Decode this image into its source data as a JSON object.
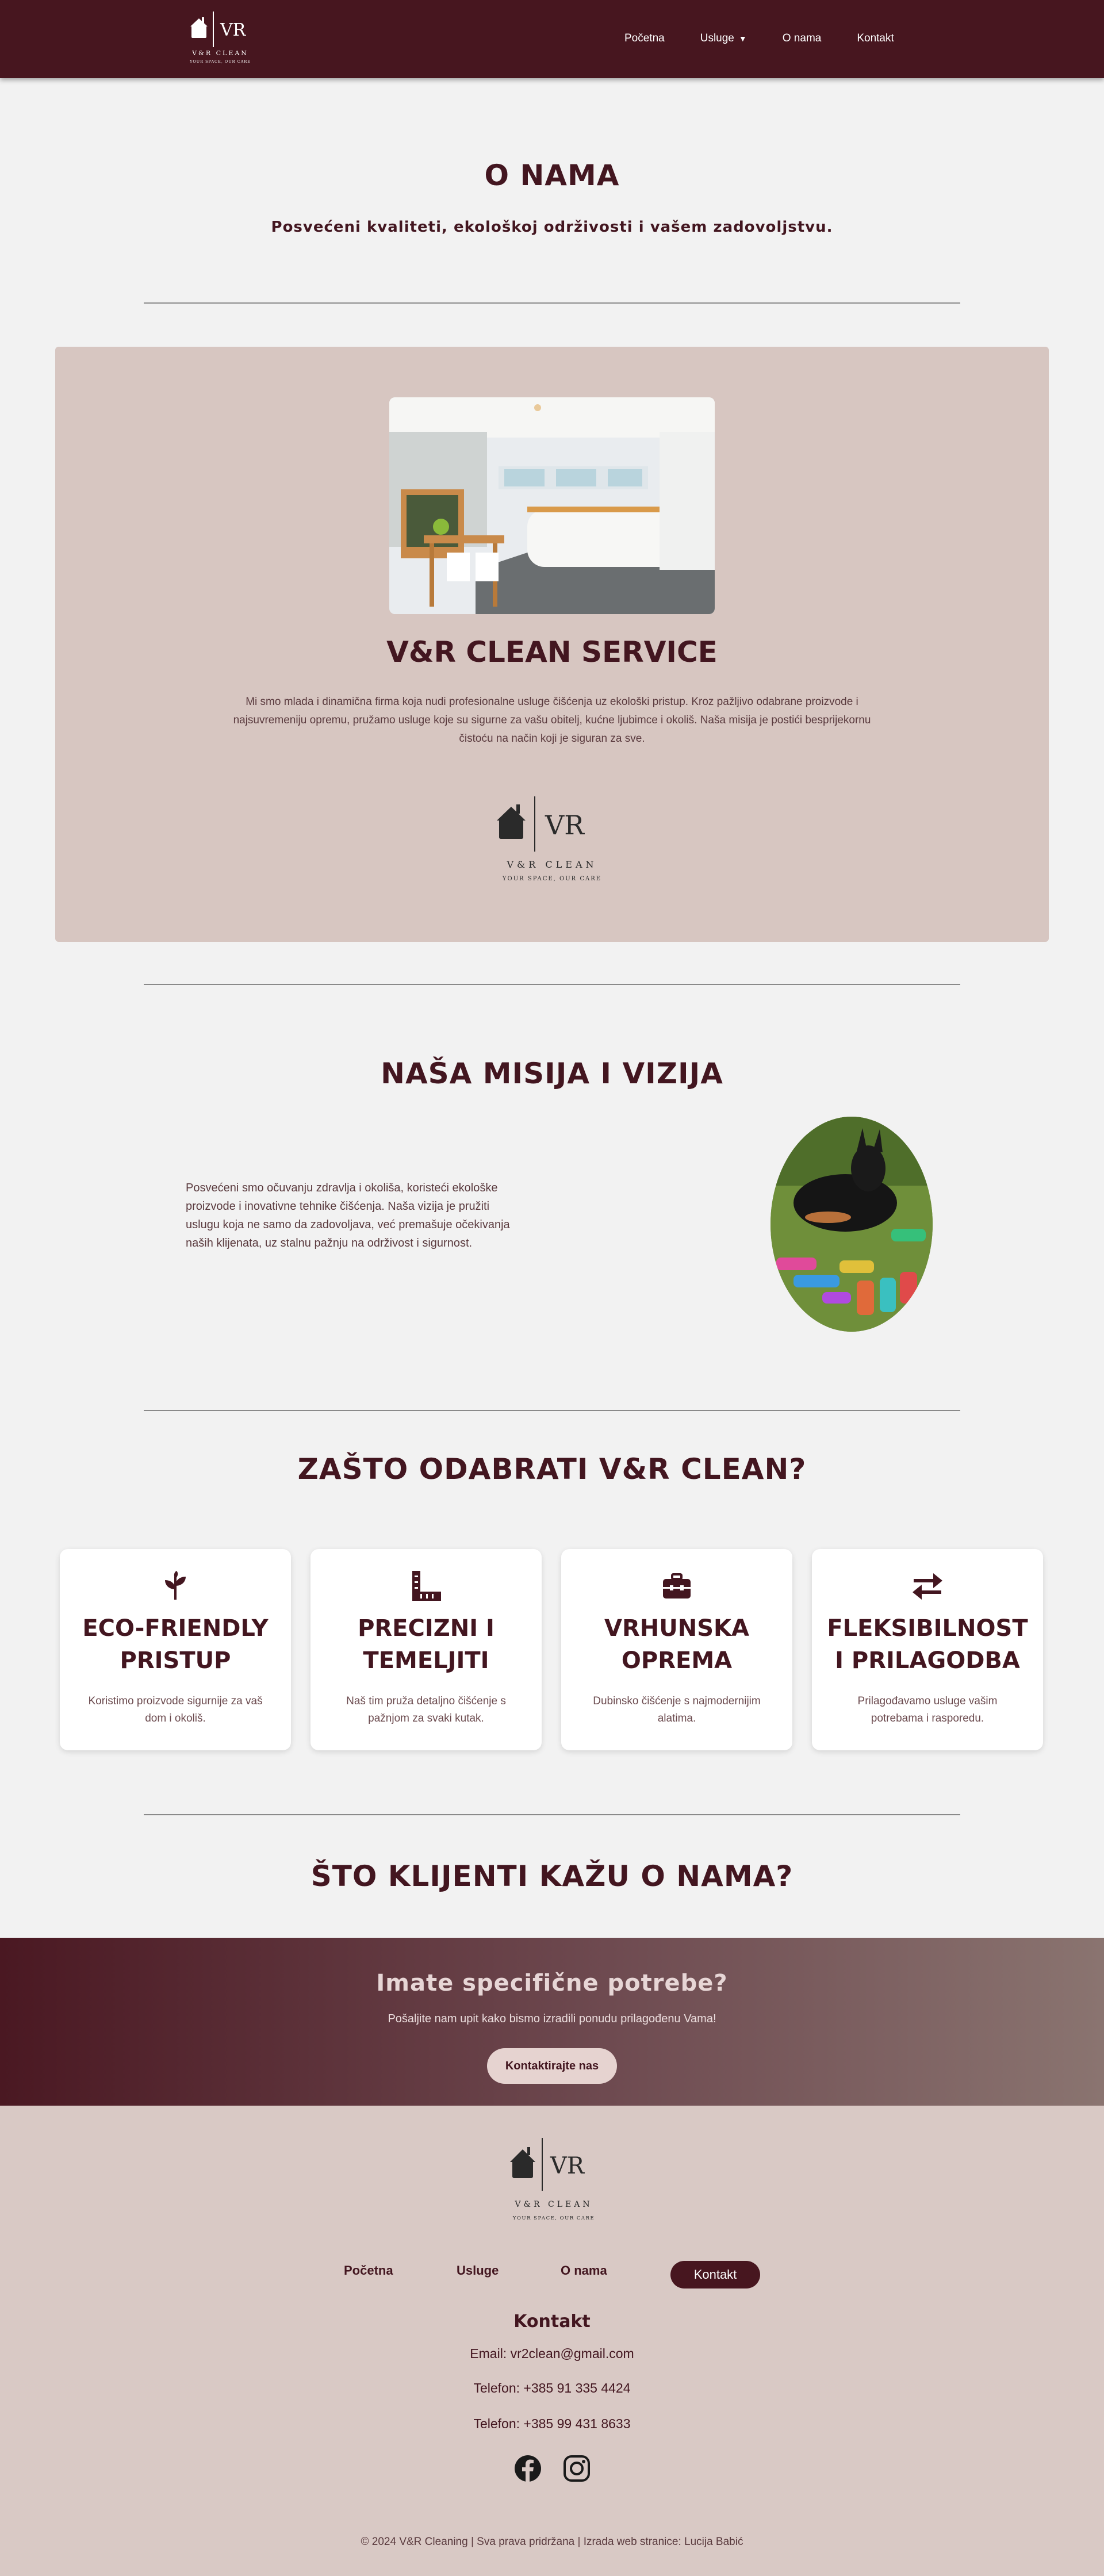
{
  "nav": {
    "logo_letters": "VR",
    "logo_name": "V&R CLEAN",
    "logo_tagline": "YOUR SPACE, OUR CARE",
    "links": [
      "Početna",
      "Usluge",
      "O nama",
      "Kontakt"
    ],
    "caret": "▼"
  },
  "hero": {
    "title": "O NAMA",
    "subtitle": "Posvećeni kvaliteti, ekološkoj održivosti i vašem zadovoljstvu."
  },
  "about": {
    "title": "V&R CLEAN SERVICE",
    "text": "Mi smo mlada i dinamična firma koja nudi profesionalne usluge čišćenja uz ekološki pristup. Kroz pažljivo odabrane proizvode i najsuvremeniju opremu, pružamo usluge koje su sigurne za vašu obitelj, kućne ljubimce i okoliš. Naša misija je postići besprijekornu čistoću na način koji je siguran za sve.",
    "logo_letters": "VR",
    "logo_name": "V&R CLEAN",
    "logo_tagline": "YOUR SPACE, OUR CARE"
  },
  "mission": {
    "title": "NAŠA MISIJA I VIZIJA",
    "text": "Posvećeni smo očuvanju zdravlja i okoliša, koristeći ekološke proizvode i inovativne tehnike čišćenja. Naša vizija je pružiti uslugu koja ne samo da zadovoljava, već premašuje očekivanja naših klijenata, uz stalnu pažnju na održivost i sigurnost."
  },
  "why": {
    "title": "ZAŠTO ODABRATI V&R CLEAN?",
    "features": [
      {
        "icon": "leaf-icon",
        "title": "ECO-FRIENDLY PRISTUP",
        "desc": "Koristimo proizvode sigurnije za vaš dom i okoliš."
      },
      {
        "icon": "ruler-icon",
        "title": "PRECIZNI I TEMELJITI",
        "desc": "Naš tim pruža detaljno čišćenje s pažnjom za svaki kutak."
      },
      {
        "icon": "toolbox-icon",
        "title": "VRHUNSKA OPREMA",
        "desc": "Dubinsko čišćenje s najmodernijim alatima."
      },
      {
        "icon": "arrows-exchange-icon",
        "title": "FLEKSIBILNOST I PRILAGODBA",
        "desc": "Prilagođavamo usluge vašim potrebama i rasporedu."
      }
    ]
  },
  "testimonials": {
    "title": "ŠTO KLIJENTI KAŽU O NAMA?"
  },
  "cta": {
    "title": "Imate specifične potrebe?",
    "text": "Pošaljite nam upit kako bismo izradili ponudu prilagođenu Vama!",
    "button": "Kontaktirajte nas"
  },
  "footer": {
    "logo_letters": "VR",
    "logo_name": "V&R CLEAN",
    "logo_tagline": "YOUR SPACE, OUR CARE",
    "nav": [
      "Početna",
      "Usluge",
      "O nama"
    ],
    "contact_button": "Kontakt",
    "contact_title": "Kontakt",
    "email": "Email: vr2clean@gmail.com",
    "phone1": "Telefon: +385 91 335 4424",
    "phone2": "Telefon: +385 99 431 8633",
    "social": [
      "facebook-icon",
      "instagram-icon"
    ],
    "copyright": "© 2024 V&R Cleaning | Sva prava pridržana | Izrada web stranice: Lucija Babić"
  },
  "colors": {
    "brand": "#47161f",
    "card_bg": "#d7c6c1",
    "footer_bg": "#d9c9c5",
    "page_bg": "#f2f2f2"
  }
}
